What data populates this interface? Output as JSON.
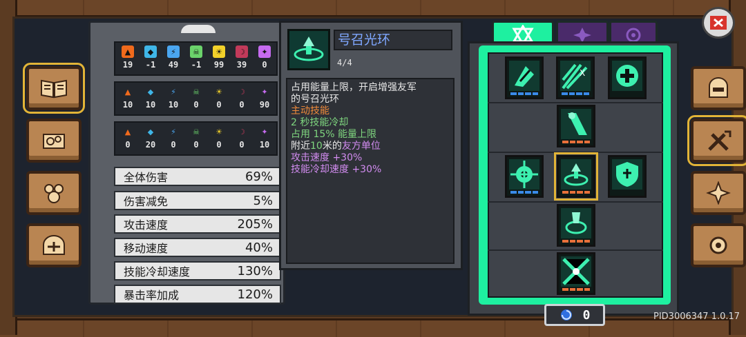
{
  "colors": {
    "accent_green": "#1ef0a0",
    "skill_name": "#7fa7ff",
    "desc_white": "#e8e8e8",
    "desc_orange": "#f08a3a",
    "desc_green": "#7fd67f",
    "desc_purple": "#d28cf0",
    "highlight_yellow": "#e2b437"
  },
  "left_nav": [
    "book-icon",
    "scroll-icon",
    "pets-icon",
    "helmet-icon"
  ],
  "right_nav": [
    "hero-helmet-icon",
    "crossed-swords-up-icon",
    "compass-icon",
    "gear-icon"
  ],
  "elemental_grid": [
    {
      "row": "damage",
      "values": [
        "19",
        "-1",
        "49",
        "-1",
        "99",
        "39",
        "0"
      ]
    },
    {
      "row": "chance",
      "values": [
        "10",
        "10",
        "10",
        "0",
        "0",
        "0",
        "90"
      ]
    },
    {
      "row": "duration",
      "values": [
        "0",
        "20",
        "0",
        "0",
        "0",
        "0",
        "10"
      ]
    }
  ],
  "elements": [
    {
      "name": "fire-icon",
      "color": "#f06a1c"
    },
    {
      "name": "ice-icon",
      "color": "#3fb6e8"
    },
    {
      "name": "lightning-icon",
      "color": "#4aa6f0"
    },
    {
      "name": "poison-icon",
      "color": "#6bd36b"
    },
    {
      "name": "light-icon",
      "color": "#f2d12a"
    },
    {
      "name": "dark-icon",
      "color": "#c23a5a"
    },
    {
      "name": "arcane-icon",
      "color": "#c66bf0"
    }
  ],
  "stats": [
    {
      "label": "全体伤害",
      "value": "69%"
    },
    {
      "label": "伤害减免",
      "value": "5%"
    },
    {
      "label": "攻击速度",
      "value": "205%"
    },
    {
      "label": "移动速度",
      "value": "40%"
    },
    {
      "label": "技能冷却速度",
      "value": "130%"
    },
    {
      "label": "暴击率加成",
      "value": "120%"
    }
  ],
  "skill": {
    "name": "号召光环",
    "level": "4/4",
    "desc": [
      {
        "text": "占用能量上限，开启增强友军",
        "color": "white"
      },
      {
        "text": "的号召光环",
        "color": "white"
      },
      {
        "text": "主动技能",
        "color": "orange"
      },
      {
        "text": "2 秒技能冷却",
        "color": "green"
      },
      {
        "text": "占用 15% 能量上限",
        "color": "green"
      }
    ],
    "desc_line_near": {
      "prefix": "附近",
      "num": "10",
      "mid": "米的",
      "purple": "友方单位"
    },
    "desc_tail": [
      {
        "text": "攻击速度 +30%",
        "color": "purple"
      },
      {
        "text": "技能冷却速度 +30%",
        "color": "purple"
      }
    ]
  },
  "tree_tabs": [
    {
      "name": "tab-hexagram",
      "active": true
    },
    {
      "name": "tab-purple-1",
      "active": false
    },
    {
      "name": "tab-purple-2",
      "active": false
    }
  ],
  "points": "0",
  "version": "PID3006347 1.0.17"
}
